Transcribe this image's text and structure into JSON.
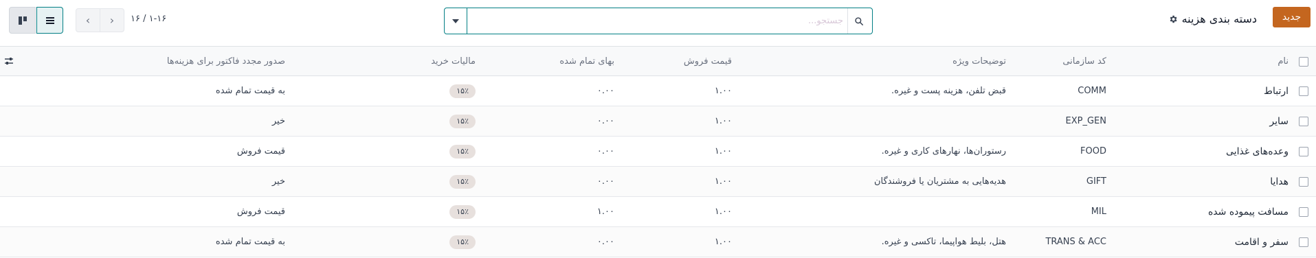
{
  "header": {
    "new_button": "جدید",
    "title": "دسته بندی هزینه",
    "search_placeholder": "جستجو...",
    "pager_text": "۱-۱۶ / ۱۶"
  },
  "columns": {
    "name": "نام",
    "code": "کد سازمانی",
    "description": "توضیحات ویژه",
    "sale_price": "قیمت فروش",
    "cost": "بهای تمام شده",
    "purchase_tax": "مالیات خرید",
    "reinvoice": "صدور مجدد فاکتور برای هزینه‌ها"
  },
  "rows": [
    {
      "name": "ارتباط",
      "code": "COMM",
      "description": "قبض تلفن، هزینه پست و غیره.",
      "sale_price": "۱.۰۰",
      "cost": "۰.۰۰",
      "tax": "۱۵٪",
      "reinvoice": "به قیمت تمام شده"
    },
    {
      "name": "سایر",
      "code": "EXP_GEN",
      "description": "",
      "sale_price": "۱.۰۰",
      "cost": "۰.۰۰",
      "tax": "۱۵٪",
      "reinvoice": "خیر"
    },
    {
      "name": "وعده‌های غذایی",
      "code": "FOOD",
      "description": "رستوران‌ها، نهارهای کاری و غیره.",
      "sale_price": "۱.۰۰",
      "cost": "۰.۰۰",
      "tax": "۱۵٪",
      "reinvoice": "قیمت فروش"
    },
    {
      "name": "هدایا",
      "code": "GIFT",
      "description": "هدیه‌هایی به مشتریان یا فروشندگان",
      "sale_price": "۱.۰۰",
      "cost": "۰.۰۰",
      "tax": "۱۵٪",
      "reinvoice": "خیر"
    },
    {
      "name": "مسافت پیموده شده",
      "code": "MIL",
      "description": "",
      "sale_price": "۱.۰۰",
      "cost": "۱.۰۰",
      "tax": "۱۵٪",
      "reinvoice": "قیمت فروش"
    },
    {
      "name": "سفر و اقامت",
      "code": "TRANS & ACC",
      "description": "هتل، بلیط هواپیما، تاکسی و غیره.",
      "sale_price": "۱.۰۰",
      "cost": "۰.۰۰",
      "tax": "۱۵٪",
      "reinvoice": "به قیمت تمام شده"
    }
  ],
  "icons": {
    "settings": "gear-icon",
    "search": "search-icon",
    "dropdown": "caret-down-icon",
    "prev": "chevron-left-icon",
    "next": "chevron-right-icon",
    "kanban": "kanban-view-icon",
    "list": "list-view-icon",
    "optional_columns": "sliders-icon"
  },
  "colors": {
    "primary": "#c4661f",
    "accent": "#017e84",
    "tax_badge": "#e7e0dd"
  }
}
